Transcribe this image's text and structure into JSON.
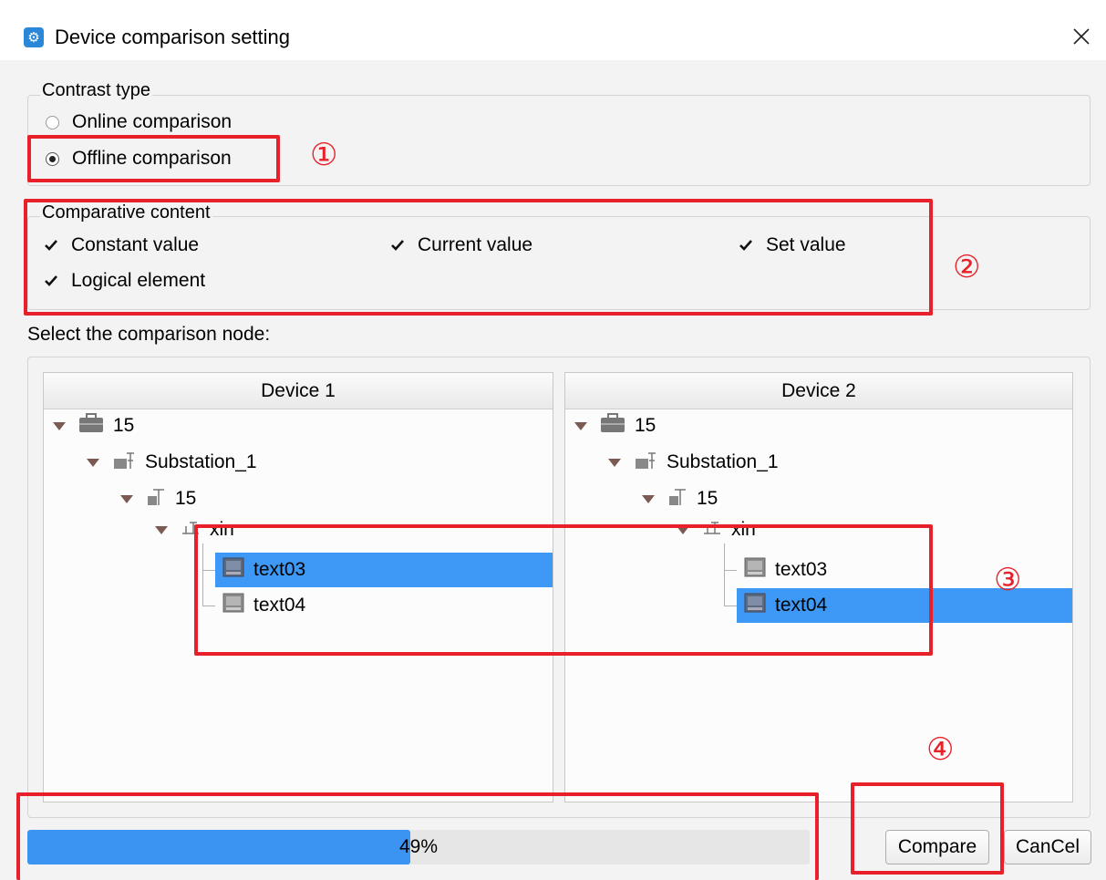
{
  "window": {
    "title": "Device comparison setting",
    "app_icon": "gear-icon",
    "close_glyph": "✕"
  },
  "contrast_type": {
    "legend": "Contrast type",
    "options": [
      {
        "label": "Online comparison",
        "checked": false
      },
      {
        "label": "Offline comparison",
        "checked": true
      }
    ]
  },
  "comparative_content": {
    "legend": "Comparative content",
    "items": [
      {
        "label": "Constant value",
        "checked": true
      },
      {
        "label": "Current value",
        "checked": true
      },
      {
        "label": "Set value",
        "checked": true
      },
      {
        "label": "Logical element",
        "checked": true
      }
    ]
  },
  "select_node_label": "Select the comparison node:",
  "device1": {
    "header": "Device 1",
    "nodes": [
      "15",
      "Substation_1",
      "15",
      "xin",
      "text03",
      "text04"
    ],
    "selected": "text03"
  },
  "device2": {
    "header": "Device 2",
    "nodes": [
      "15",
      "Substation_1",
      "15",
      "xin",
      "text03",
      "text04"
    ],
    "selected": "text04"
  },
  "progress": {
    "value": 0.49,
    "text": "49%"
  },
  "buttons": {
    "compare": "Compare",
    "cancel": "CanCel"
  },
  "annotations": [
    "①",
    "②",
    "③",
    "④"
  ],
  "colors": {
    "selection": "#3d99f5",
    "progress": "#3b93f2",
    "annotation": "#e8202a"
  }
}
